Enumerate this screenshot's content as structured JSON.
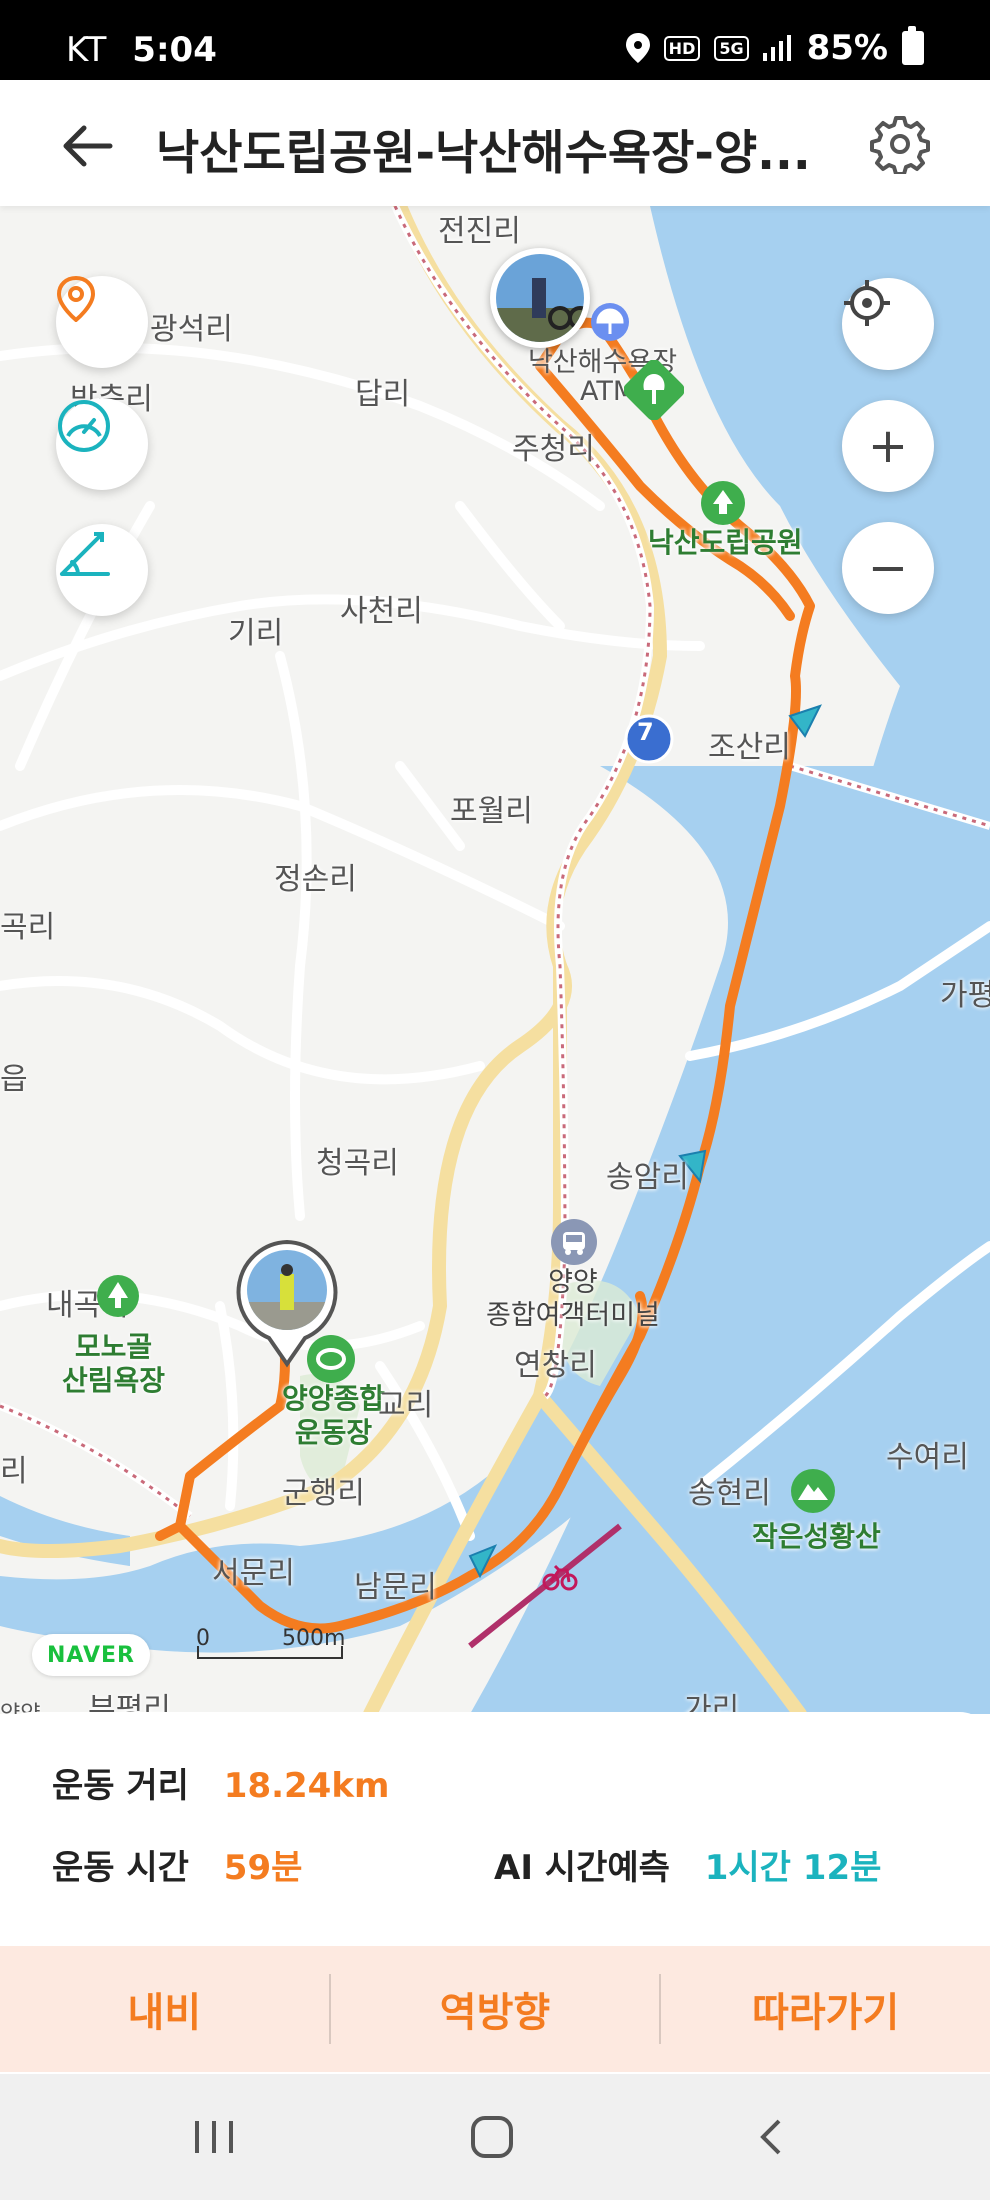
{
  "status_bar": {
    "carrier": "KT",
    "time": "5:04",
    "badges": [
      "HD",
      "5G"
    ],
    "battery": "85%"
  },
  "header": {
    "title": "낙산도립공원-낙산해수욕장-양...",
    "back_icon": "arrow-left-icon",
    "settings_icon": "gear-icon"
  },
  "map": {
    "places": [
      {
        "id": "jeonjin",
        "text": "전진리"
      },
      {
        "id": "gwangseok",
        "text": "광석리"
      },
      {
        "id": "bangchuk",
        "text": "방축리"
      },
      {
        "id": "dap",
        "text": "답리"
      },
      {
        "id": "juchung",
        "text": "주청리"
      },
      {
        "id": "beach",
        "text": "낙산해수욕장"
      },
      {
        "id": "atm",
        "text": "ATM"
      },
      {
        "id": "park",
        "text": "낙산도립공원"
      },
      {
        "id": "giri",
        "text": "기리"
      },
      {
        "id": "sacheon",
        "text": "사천리"
      },
      {
        "id": "josan",
        "text": "조산리"
      },
      {
        "id": "powol",
        "text": "포월리"
      },
      {
        "id": "jeongson",
        "text": "정손리"
      },
      {
        "id": "gokri",
        "text": "곡리"
      },
      {
        "id": "eup",
        "text": "읍"
      },
      {
        "id": "gap",
        "text": "가평"
      },
      {
        "id": "cheonggok",
        "text": "청곡리"
      },
      {
        "id": "songam",
        "text": "송암리"
      },
      {
        "id": "naegok",
        "text": "내곡리"
      },
      {
        "id": "monogol",
        "text": "모노골\n산림욕장"
      },
      {
        "id": "terminal",
        "text": "양양\n종합여객터미널"
      },
      {
        "id": "yeonchang",
        "text": "연창리"
      },
      {
        "id": "stadium",
        "text": "양양종합\n운동장"
      },
      {
        "id": "gyori",
        "text": "교리"
      },
      {
        "id": "gunhaeng",
        "text": "군행리"
      },
      {
        "id": "seomun",
        "text": "서문리"
      },
      {
        "id": "nammun",
        "text": "남문리"
      },
      {
        "id": "songhyeon",
        "text": "송현리"
      },
      {
        "id": "seonghwang",
        "text": "작은성황산"
      },
      {
        "id": "suyeo",
        "text": "수여리"
      },
      {
        "id": "ri",
        "text": "리"
      },
      {
        "id": "bupyeong",
        "text": "부평리"
      },
      {
        "id": "garri",
        "text": "가리"
      },
      {
        "id": "yangyang",
        "text": "양양"
      }
    ],
    "route_number": "7",
    "naver_logo": "NAVER",
    "scale": {
      "start": "0",
      "end": "500m"
    },
    "colors": {
      "route": "#f47c20",
      "water": "#a6d0f0",
      "road": "#f5dfa0",
      "arrow": "#33b5c8"
    }
  },
  "buttons": {
    "marker": "location-pin-icon",
    "speed": "speedometer-icon",
    "elevation": "elevation-icon",
    "locate": "crosshair-icon",
    "zoom_in": "+",
    "zoom_out": "−"
  },
  "info": {
    "distance_label": "운동 거리",
    "distance_value": "18.24km",
    "time_label": "운동 시간",
    "time_value": "59분",
    "ai_label": "AI 시간예측",
    "ai_value": "1시간 12분"
  },
  "actions": {
    "navi": "내비",
    "reverse": "역방향",
    "follow": "따라가기"
  }
}
